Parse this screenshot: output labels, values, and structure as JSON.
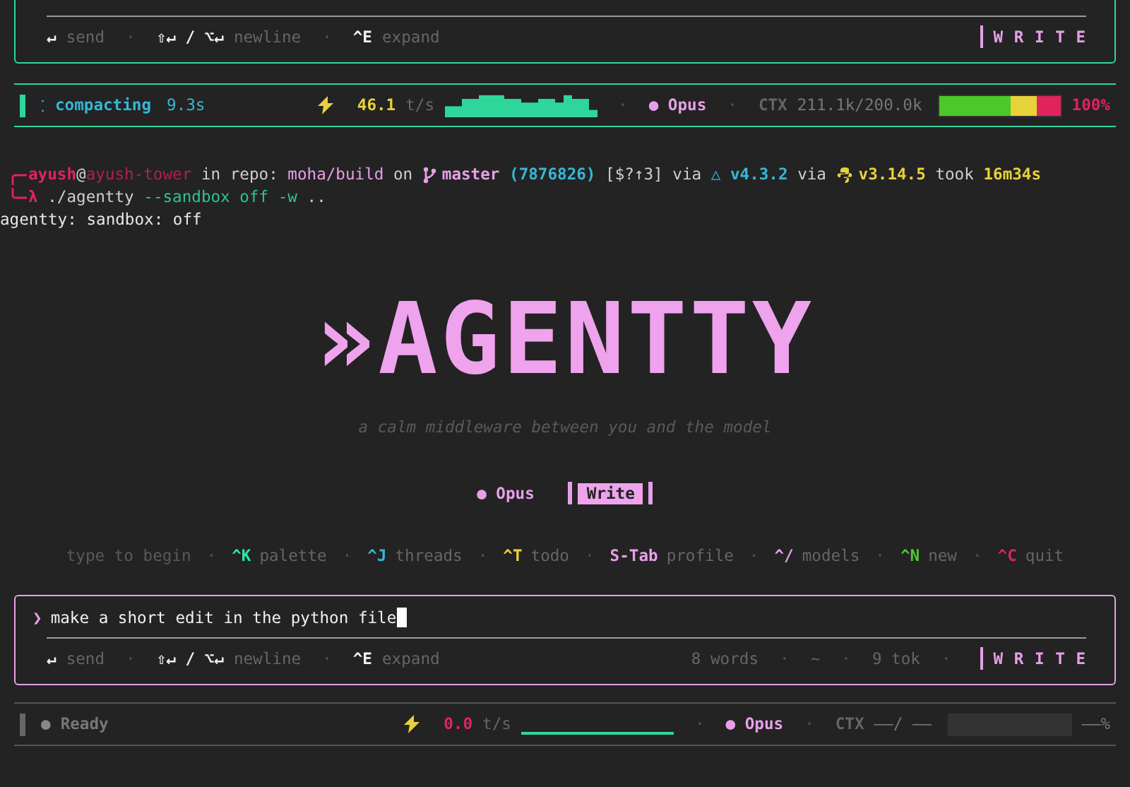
{
  "separator": "·",
  "composers": [
    {
      "focused": false,
      "hints": [
        {
          "key": "↵",
          "label": "send"
        },
        {
          "key": "⇧↵ / ⌥↵",
          "label": "newline"
        },
        {
          "key": "^E",
          "label": "expand"
        }
      ],
      "mode": "W R I T E"
    },
    {
      "focused": true,
      "prompt": "❯",
      "input": "make a short edit in the python file",
      "hints": [
        {
          "key": "↵",
          "label": "send"
        },
        {
          "key": "⇧↵ / ⌥↵",
          "label": "newline"
        },
        {
          "key": "^E",
          "label": "expand"
        }
      ],
      "counts": [
        "8 words",
        "~",
        "9 tok"
      ],
      "mode": "W R I T E"
    }
  ],
  "status_bars": [
    {
      "busy": true,
      "status_icon": "⁚",
      "status": "compacting",
      "elapsed": "9.3s",
      "speed": "46.1",
      "stalled": false,
      "speed_unit": "t/s",
      "model": "● Opus",
      "ctx_label": "CTX",
      "ctx": "211.1k/200.0k",
      "ctx_meter": {
        "level": 1
      },
      "ctx_percent": "100%"
    },
    {
      "busy": false,
      "status_icon": "●",
      "status": "Ready",
      "speed": "0.0",
      "stalled": true,
      "speed_unit": "t/s",
      "model": "● Opus",
      "ctx_label": "CTX",
      "ctx": "——/  ——",
      "ctx_meter": {
        "level": 0
      },
      "ctx_percent": "——%"
    }
  ],
  "shell": {
    "lines": [
      [
        {
          "kind": "text",
          "text": "ayush",
          "color": "#e0245e",
          "bold": true
        },
        {
          "kind": "text",
          "text": "@",
          "color": "#cfcfcf",
          "bold": false
        },
        {
          "kind": "text",
          "text": "ayush-tower",
          "color": "#b02248",
          "bold": false
        },
        {
          "kind": "text",
          "text": " in repo: ",
          "color": "#cfcfcf",
          "bold": false
        },
        {
          "kind": "text",
          "text": "moha/build",
          "color": "#e7a0e8",
          "bold": false
        },
        {
          "kind": "text",
          "text": " on ",
          "color": "#cfcfcf",
          "bold": false
        },
        {
          "kind": "branch",
          "text": "master",
          "color": "#e7a0e8",
          "bold": true
        },
        {
          "kind": "text",
          "text": " (7876826)",
          "color": "#36b7d6",
          "bold": true
        },
        {
          "kind": "text",
          "text": " [$?↑3]",
          "color": "#cfcfcf",
          "bold": false
        },
        {
          "kind": "text",
          "text": " via ",
          "color": "#cfcfcf",
          "bold": false
        },
        {
          "kind": "text",
          "text": "△ v4.3.2",
          "color": "#36b7d6",
          "bold": true
        },
        {
          "kind": "text",
          "text": " via ",
          "color": "#cfcfcf",
          "bold": false
        },
        {
          "kind": "python",
          "text": "v3.14.5",
          "color": "#e8d23a",
          "bold": true
        },
        {
          "kind": "text",
          "text": " took ",
          "color": "#cfcfcf",
          "bold": false
        },
        {
          "kind": "text",
          "text": "16m34s",
          "color": "#e8d23a",
          "bold": true
        }
      ],
      [
        {
          "kind": "text",
          "text": "λ",
          "color": "#e0245e",
          "bold": true
        },
        {
          "kind": "text",
          "text": " ./agentty ",
          "color": "#cfcfcf",
          "bold": false
        },
        {
          "kind": "text",
          "text": "--sandbox off -w",
          "color": "#2fc48d",
          "bold": false
        },
        {
          "kind": "text",
          "text": " ..",
          "color": "#cfcfcf",
          "bold": false
        }
      ],
      [
        {
          "kind": "text",
          "text": "agentty: sandbox: off",
          "color": "#e8e8e8",
          "bold": false
        }
      ]
    ]
  },
  "logo": "»AGENTTY",
  "tagline": "a calm middleware between you and the model",
  "model": "● Opus",
  "profile": "Write",
  "shortcuts": [
    {
      "label": "type to begin",
      "color": "#5a5a5a"
    },
    {
      "key": "^K",
      "label": "palette",
      "color": "#2ee6b0"
    },
    {
      "key": "^J",
      "label": "threads",
      "color": "#36b7d6"
    },
    {
      "key": "^T",
      "label": "todo",
      "color": "#e8d23a"
    },
    {
      "key": "S-Tab",
      "label": "profile",
      "color": "#e7a0e8"
    },
    {
      "key": "^/",
      "label": "models",
      "color": "#e7a0e8"
    },
    {
      "key": "^N",
      "label": "new",
      "color": "#4cc92a"
    },
    {
      "key": "^C",
      "label": "quit",
      "color": "#e0245e"
    }
  ]
}
